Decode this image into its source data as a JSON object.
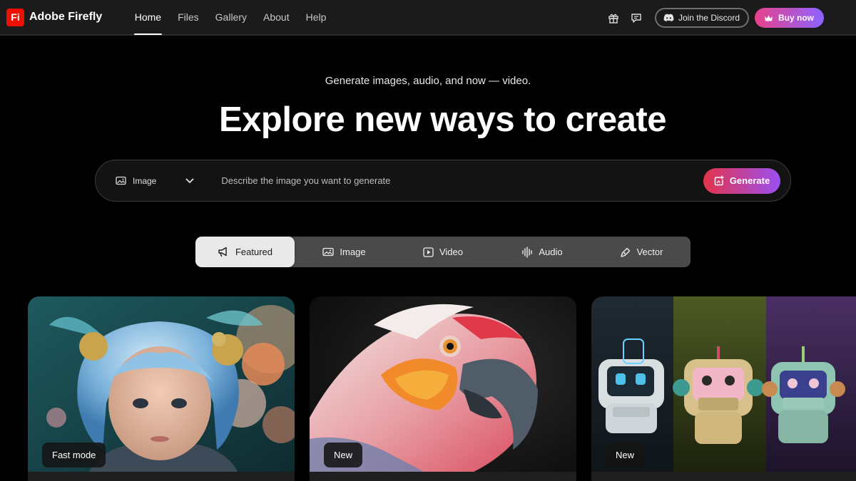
{
  "app": {
    "logo_text": "Fi",
    "name": "Adobe Firefly",
    "brand_color": "#eb1000"
  },
  "nav": {
    "items": [
      {
        "label": "Home",
        "active": true
      },
      {
        "label": "Files",
        "active": false
      },
      {
        "label": "Gallery",
        "active": false
      },
      {
        "label": "About",
        "active": false
      },
      {
        "label": "Help",
        "active": false
      }
    ]
  },
  "top_actions": {
    "gift_icon": "gift-icon",
    "feedback_icon": "chat-bubble-icon",
    "discord_label": "Join the Discord",
    "buy_label": "Buy now",
    "buy_gradient": [
      "#e8418a",
      "#8d63ff"
    ]
  },
  "hero": {
    "subtitle": "Generate images, audio, and now — video.",
    "headline": "Explore new ways to create"
  },
  "prompt": {
    "mode": "Image",
    "placeholder": "Describe the image you want to generate",
    "value": "",
    "generate_label": "Generate",
    "generate_gradient": [
      "#e3344a",
      "#9b50f2"
    ]
  },
  "tabs": [
    {
      "label": "Featured",
      "icon": "megaphone-icon",
      "active": true
    },
    {
      "label": "Image",
      "icon": "image-icon",
      "active": false
    },
    {
      "label": "Video",
      "icon": "play-icon",
      "active": false
    },
    {
      "label": "Audio",
      "icon": "waveform-icon",
      "active": false
    },
    {
      "label": "Vector",
      "icon": "pen-icon",
      "active": false
    }
  ],
  "cards": [
    {
      "badge": "Fast mode",
      "image": "portrait of a blue-haired child with ornate floral headdress"
    },
    {
      "badge": "New",
      "image": "close-up of a colorful parrot"
    },
    {
      "badge": "New",
      "image": "three knitted BOT robot toys"
    }
  ]
}
